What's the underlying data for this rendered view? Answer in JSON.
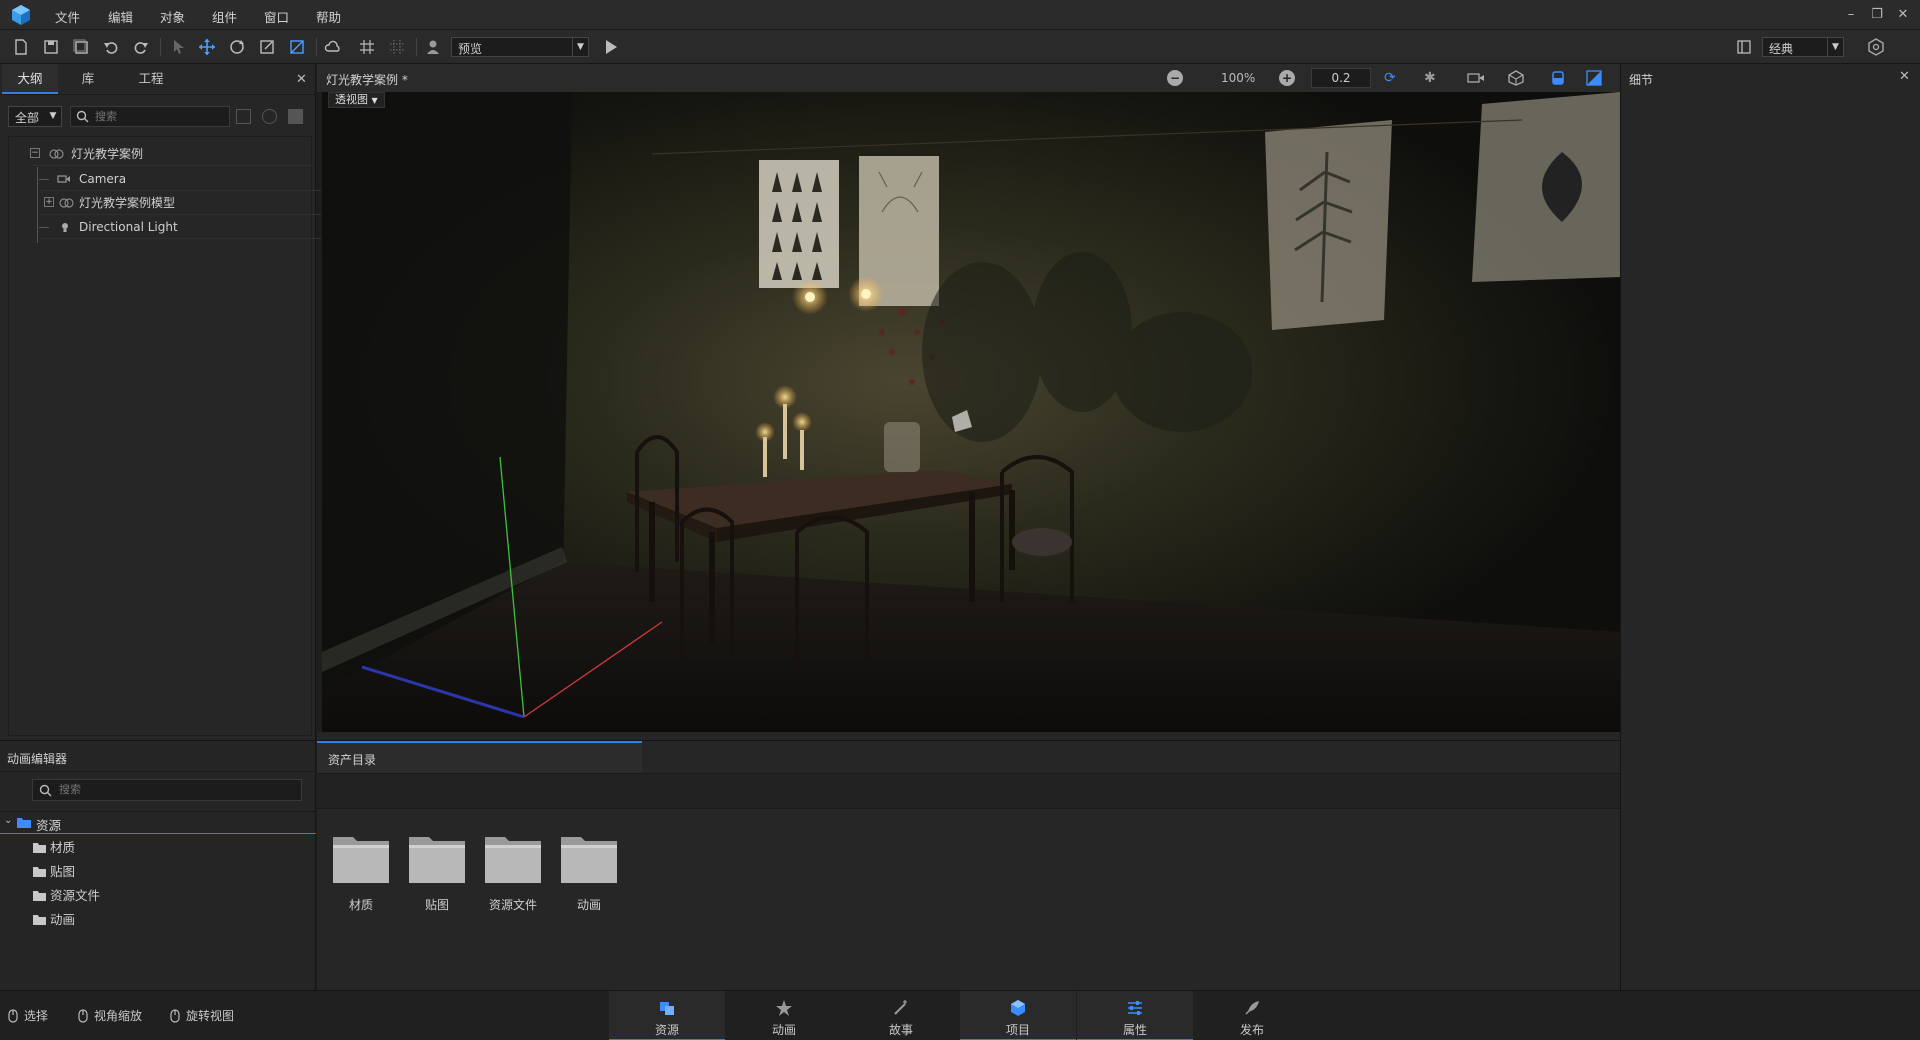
{
  "menu": [
    "文件",
    "编辑",
    "对象",
    "组件",
    "窗口",
    "帮助"
  ],
  "toolbar": {
    "mode_select": "预览",
    "layout_select": "经典"
  },
  "left_panel": {
    "tabs": [
      "大纲",
      "库",
      "工程"
    ],
    "filter": "全部",
    "search_placeholder": "搜索",
    "tree": [
      {
        "label": "灯光教学案例",
        "icon": "group-icon"
      },
      {
        "label": "Camera",
        "icon": "camera-icon"
      },
      {
        "label": "灯光教学案例模型",
        "icon": "group-icon"
      },
      {
        "label": "Directional Light",
        "icon": "light-icon"
      }
    ]
  },
  "viewport": {
    "tab_title": "灯光教学案例 *",
    "view_mode": "透视图",
    "zoom": "100%",
    "step": "0.2"
  },
  "right_panel": {
    "title": "细节"
  },
  "anim_panel": {
    "title": "动画编辑器",
    "search_placeholder": "搜索",
    "root": "资源",
    "folders": [
      "材质",
      "贴图",
      "资源文件",
      "动画"
    ]
  },
  "asset_panel": {
    "title": "资产目录",
    "folders": [
      "材质",
      "贴图",
      "资源文件",
      "动画"
    ]
  },
  "status": {
    "items": [
      "选择",
      "视角缩放",
      "旋转视图"
    ]
  },
  "bottom_nav": [
    "资源",
    "动画",
    "故事",
    "项目",
    "属性",
    "发布"
  ],
  "colors": {
    "accent": "#2f7fe6",
    "bg": "#1e1e1e",
    "panel": "#262626"
  }
}
